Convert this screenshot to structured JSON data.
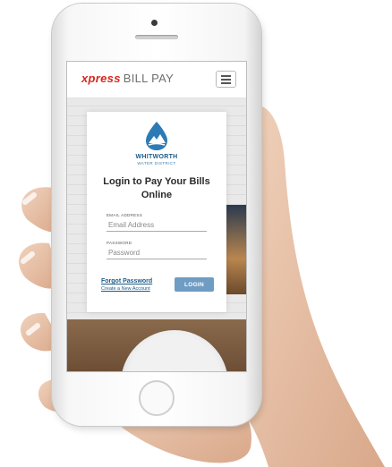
{
  "header": {
    "brand_primary": "xpress",
    "brand_secondary": "BILL PAY",
    "menu_icon": "hamburger-menu-icon"
  },
  "org": {
    "name": "WHITWORTH",
    "subtitle": "WATER DISTRICT",
    "logo_icon": "water-drop-mountain-icon"
  },
  "login": {
    "title": "Login to Pay Your Bills Online",
    "email_label": "EMAIL ADDRESS",
    "email_placeholder": "Email Address",
    "password_label": "PASSWORD",
    "password_placeholder": "Password",
    "forgot_label": "Forgot Password",
    "create_label": "Create a New Account",
    "login_button": "LOGIN"
  },
  "colors": {
    "brand_red": "#d9261c",
    "link_blue": "#1c5b86",
    "button_blue": "#6f9cc2"
  }
}
